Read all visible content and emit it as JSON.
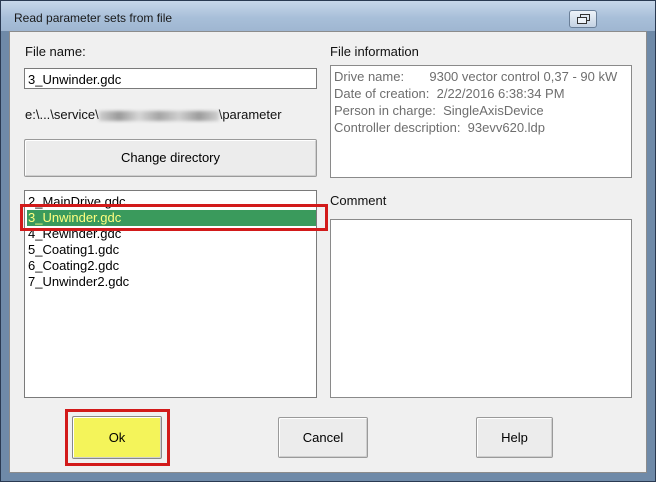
{
  "window": {
    "title": "Read parameter sets from file"
  },
  "file_name": {
    "label": "File name:",
    "value": "3_Unwinder.gdc"
  },
  "path": {
    "prefix": "e:\\...\\service\\",
    "suffix": "\\parameter"
  },
  "buttons": {
    "change_directory": "Change directory",
    "ok": "Ok",
    "cancel": "Cancel",
    "help": "Help"
  },
  "files": [
    {
      "name": "2_MainDrive.gdc",
      "selected": false
    },
    {
      "name": "3_Unwinder.gdc",
      "selected": true
    },
    {
      "name": "4_Rewinder.gdc",
      "selected": false
    },
    {
      "name": "5_Coating1.gdc",
      "selected": false
    },
    {
      "name": "6_Coating2.gdc",
      "selected": false
    },
    {
      "name": "7_Unwinder2.gdc",
      "selected": false
    }
  ],
  "file_information": {
    "label": "File information",
    "lines": [
      "Drive name:       9300 vector control 0,37 - 90 kW",
      "Date of creation:  2/22/2016 6:38:34 PM",
      "Person in charge:  SingleAxisDevice",
      "Controller description:  93evv620.ldp"
    ]
  },
  "comment": {
    "label": "Comment",
    "value": ""
  },
  "colors": {
    "selection": "#3a9a5c",
    "selection_text": "#ffff80",
    "highlight": "#d21a1a",
    "ok_fill": "#f4f45a"
  }
}
